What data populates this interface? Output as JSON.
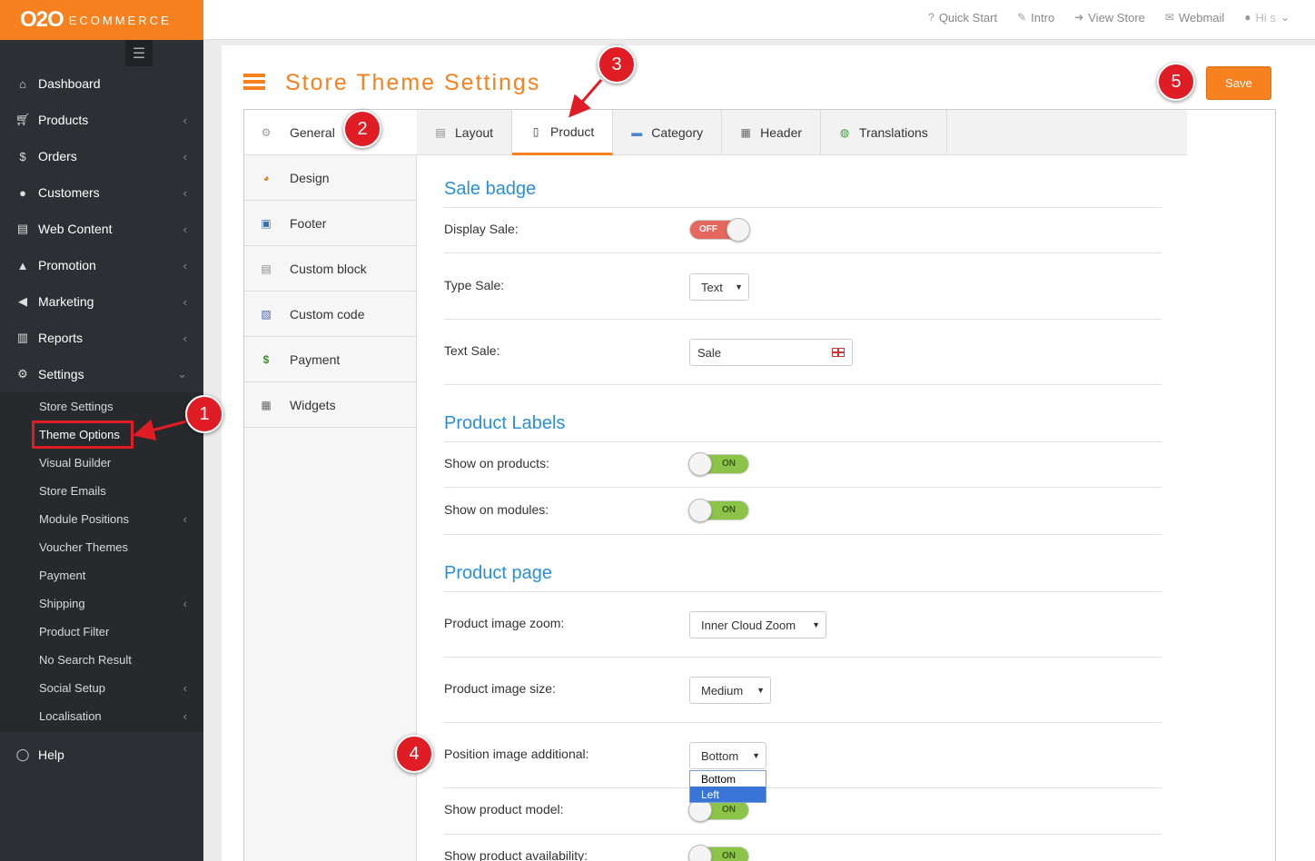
{
  "brand": {
    "logo_mark": "O2O",
    "logo_text": "ECOMMERCE"
  },
  "sidebar": {
    "items": [
      {
        "label": "Dashboard",
        "icon": "home-icon"
      },
      {
        "label": "Products",
        "icon": "cart-icon"
      },
      {
        "label": "Orders",
        "icon": "dollar-icon"
      },
      {
        "label": "Customers",
        "icon": "user-icon"
      },
      {
        "label": "Web Content",
        "icon": "book-icon"
      },
      {
        "label": "Promotion",
        "icon": "thumbs-up-icon"
      },
      {
        "label": "Marketing",
        "icon": "bullhorn-icon"
      },
      {
        "label": "Reports",
        "icon": "bar-chart-icon"
      },
      {
        "label": "Settings",
        "icon": "gears-icon"
      }
    ],
    "settings_sub": [
      "Store Settings",
      "Theme Options",
      "Visual Builder",
      "Store Emails",
      "Module Positions",
      "Voucher Themes",
      "Payment",
      "Shipping",
      "Product Filter",
      "No Search Result",
      "Social Setup",
      "Localisation"
    ],
    "help": "Help"
  },
  "topbar": {
    "quick_start": "Quick Start",
    "intro": "Intro",
    "view_store": "View Store",
    "webmail": "Webmail",
    "user": "Hi s"
  },
  "page": {
    "title": "Store Theme Settings",
    "save_label": "Save"
  },
  "left_tabs": [
    "General",
    "Design",
    "Footer",
    "Custom block",
    "Custom code",
    "Payment",
    "Widgets"
  ],
  "top_tabs": [
    "Layout",
    "Product",
    "Category",
    "Header",
    "Translations"
  ],
  "form": {
    "sale_badge_title": "Sale badge",
    "display_sale_label": "Display Sale:",
    "display_sale_state": "OFF",
    "type_sale_label": "Type Sale:",
    "type_sale_value": "Text",
    "text_sale_label": "Text Sale:",
    "text_sale_value": "Sale",
    "product_labels_title": "Product Labels",
    "show_on_products_label": "Show on products:",
    "show_on_products_state": "ON",
    "show_on_modules_label": "Show on modules:",
    "show_on_modules_state": "ON",
    "product_page_title": "Product page",
    "image_zoom_label": "Product image zoom:",
    "image_zoom_value": "Inner Cloud Zoom",
    "image_size_label": "Product image size:",
    "image_size_value": "Medium",
    "position_additional_label": "Position image additional:",
    "position_additional_value": "Bottom",
    "position_options": [
      "Bottom",
      "Left"
    ],
    "show_model_label": "Show product model:",
    "show_model_state": "ON",
    "show_availability_label": "Show product availability:",
    "show_availability_state": "ON"
  },
  "callouts": [
    "1",
    "2",
    "3",
    "4",
    "5"
  ],
  "colors": {
    "accent": "#f7801f",
    "sidebar": "#2c3034",
    "link_blue": "#2a8fd8",
    "callout_red": "#e01c24"
  }
}
